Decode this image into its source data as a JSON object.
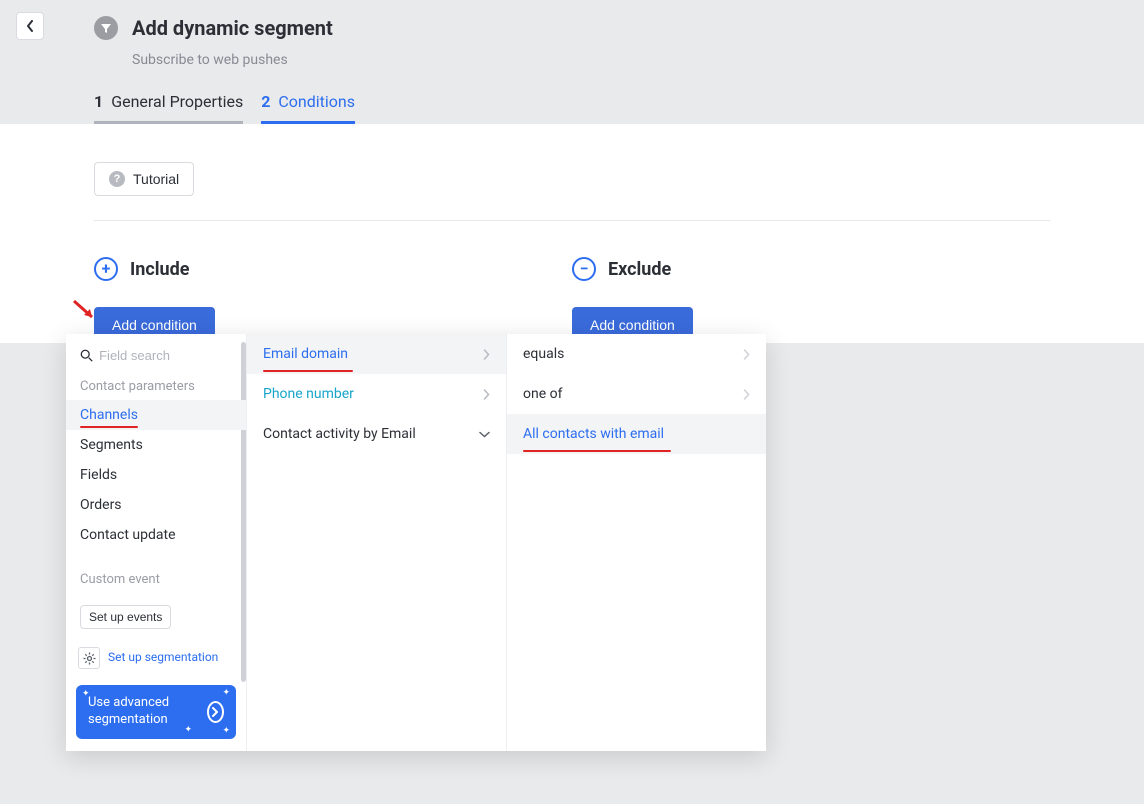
{
  "header": {
    "title": "Add dynamic segment",
    "subtitle": "Subscribe to web pushes"
  },
  "tabs": [
    {
      "num": "1",
      "label": "General Properties"
    },
    {
      "num": "2",
      "label": "Conditions"
    }
  ],
  "tutorial_label": "Tutorial",
  "include": {
    "title": "Include",
    "add_label": "Add condition"
  },
  "exclude": {
    "title": "Exclude",
    "add_label": "Add condition"
  },
  "condition_panel": {
    "search_placeholder": "Field search",
    "categories": {
      "contact_parameters_label": "Contact parameters",
      "items": [
        "Channels",
        "Segments",
        "Fields",
        "Orders",
        "Contact update"
      ],
      "custom_event_label": "Custom event",
      "setup_events_label": "Set up events",
      "setup_segmentation_label": "Set up segmentation",
      "advanced_segmentation_label": "Use advanced segmentation"
    },
    "channels_options": [
      "Email domain",
      "Phone number",
      "Contact activity by Email"
    ],
    "operators": [
      "equals",
      "one of",
      "All contacts with email"
    ]
  }
}
